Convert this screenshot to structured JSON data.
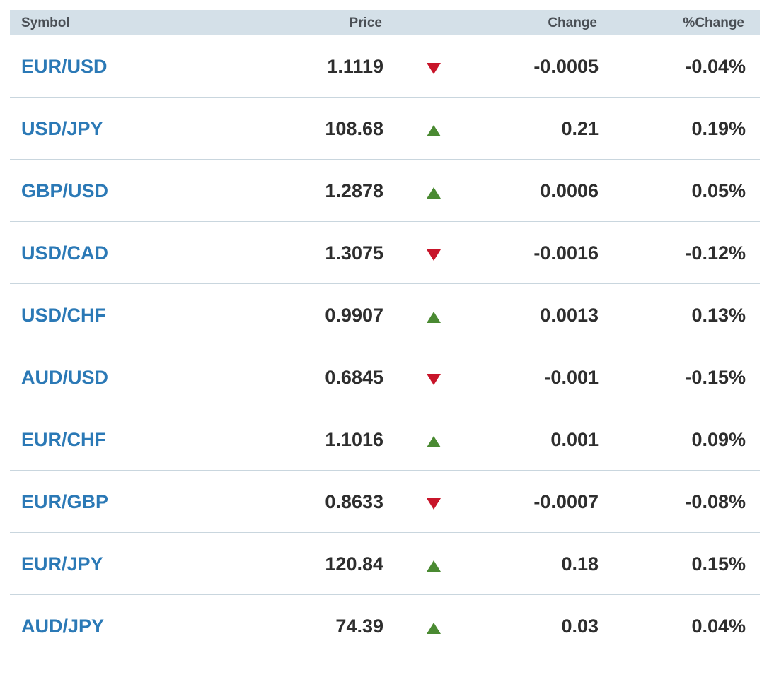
{
  "header": {
    "symbol": "Symbol",
    "price": "Price",
    "change": "Change",
    "pct_change": "%Change"
  },
  "colors": {
    "up": "#4a8a32",
    "down": "#c8152a",
    "symbol_link": "#2b79b6",
    "header_bg": "#d4e0e8"
  },
  "rows": [
    {
      "symbol": "EUR/USD",
      "price": "1.1119",
      "direction": "down",
      "change": "-0.0005",
      "pct": "-0.04%"
    },
    {
      "symbol": "USD/JPY",
      "price": "108.68",
      "direction": "up",
      "change": "0.21",
      "pct": "0.19%"
    },
    {
      "symbol": "GBP/USD",
      "price": "1.2878",
      "direction": "up",
      "change": "0.0006",
      "pct": "0.05%"
    },
    {
      "symbol": "USD/CAD",
      "price": "1.3075",
      "direction": "down",
      "change": "-0.0016",
      "pct": "-0.12%"
    },
    {
      "symbol": "USD/CHF",
      "price": "0.9907",
      "direction": "up",
      "change": "0.0013",
      "pct": "0.13%"
    },
    {
      "symbol": "AUD/USD",
      "price": "0.6845",
      "direction": "down",
      "change": "-0.001",
      "pct": "-0.15%"
    },
    {
      "symbol": "EUR/CHF",
      "price": "1.1016",
      "direction": "up",
      "change": "0.001",
      "pct": "0.09%"
    },
    {
      "symbol": "EUR/GBP",
      "price": "0.8633",
      "direction": "down",
      "change": "-0.0007",
      "pct": "-0.08%"
    },
    {
      "symbol": "EUR/JPY",
      "price": "120.84",
      "direction": "up",
      "change": "0.18",
      "pct": "0.15%"
    },
    {
      "symbol": "AUD/JPY",
      "price": "74.39",
      "direction": "up",
      "change": "0.03",
      "pct": "0.04%"
    }
  ]
}
